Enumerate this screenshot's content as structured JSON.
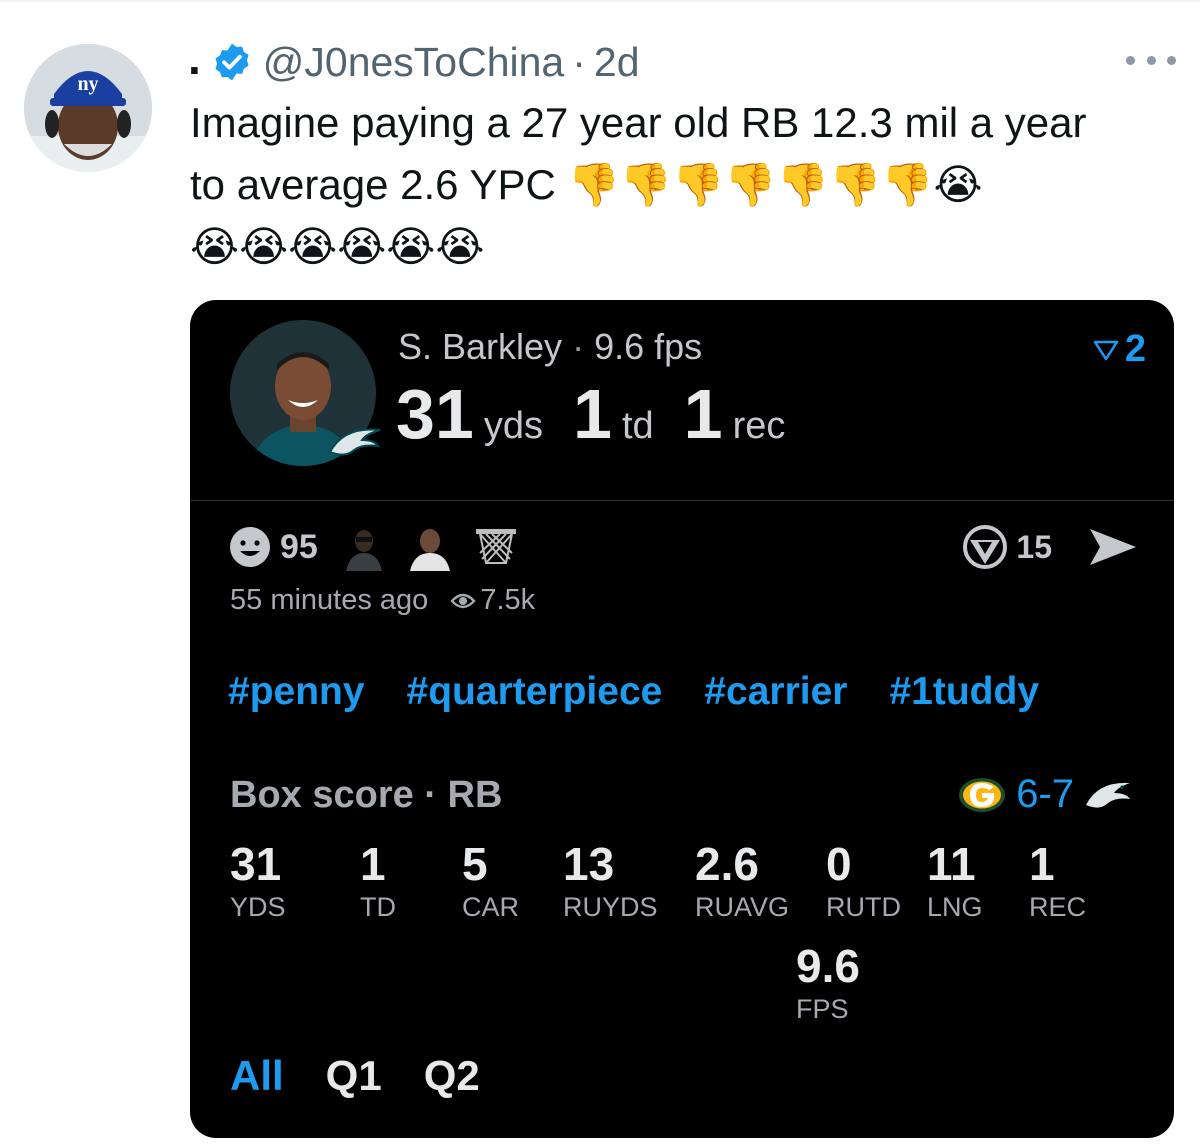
{
  "tweet": {
    "display_name": ".",
    "handle": "@J0nesToChina",
    "separator": "·",
    "age": "2d",
    "text_line1": "Imagine paying a 27 year old RB 12.3 mil a year",
    "text_line2_prefix": "to average 2.6 YPC",
    "emoji_line2": "👎👎👎👎👎👎👎😭",
    "emoji_line3": "😭😭😭😭😭😭",
    "avatar_cap_text": "ny"
  },
  "card": {
    "player_name": "S. Barkley",
    "separator": "·",
    "fps_label": "9.6 fps",
    "rank": "2",
    "statline": [
      {
        "value": "31",
        "unit": "yds"
      },
      {
        "value": "1",
        "unit": "td"
      },
      {
        "value": "1",
        "unit": "rec"
      }
    ],
    "reactions_count": "95",
    "shares_count": "15",
    "time_ago": "55 minutes ago",
    "views": "7.5k",
    "tags": [
      "#penny",
      "#quarterpiece",
      "#carrier",
      "#1tuddy"
    ],
    "box_title": "Box score · RB",
    "score": "6-7",
    "stats": [
      {
        "value": "31",
        "label": "YDS"
      },
      {
        "value": "1",
        "label": "TD"
      },
      {
        "value": "5",
        "label": "CAR"
      },
      {
        "value": "13",
        "label": "RUYDS"
      },
      {
        "value": "2.6",
        "label": "RUAVG"
      },
      {
        "value": "0",
        "label": "RUTD"
      },
      {
        "value": "11",
        "label": "LNG"
      },
      {
        "value": "1",
        "label": "REC"
      },
      {
        "value": "9.6",
        "label": "FPS"
      }
    ],
    "quarter_tabs": [
      "All",
      "Q1",
      "Q2"
    ]
  },
  "colors": {
    "accent": "#1d9bf0",
    "card_bg": "#000000",
    "muted": "#536471",
    "giants_blue": "#1a3fa0",
    "packers_green": "#1e4d2b",
    "eagles_teal": "#004c54"
  },
  "icons": [
    "verified-icon",
    "more-icon",
    "smiley-icon",
    "basketball-net-icon",
    "rank-icon",
    "share-circle-icon",
    "send-arrow-icon",
    "eye-icon",
    "packers-logo-icon",
    "eagles-logo-icon"
  ]
}
